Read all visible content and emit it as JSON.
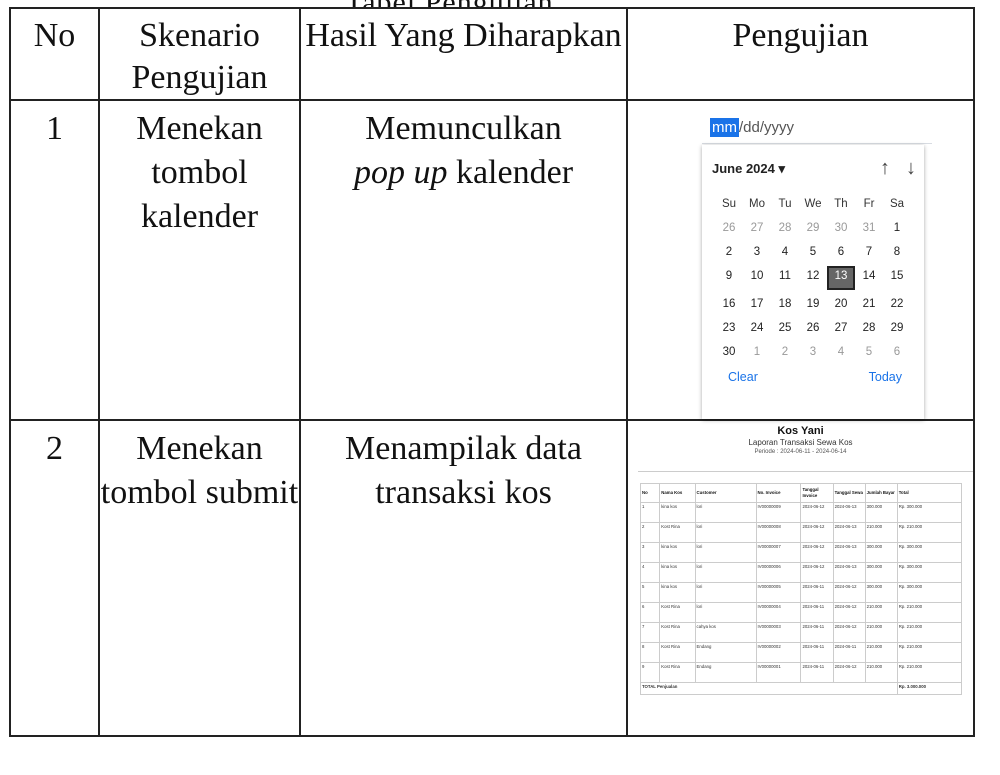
{
  "caption_fragment": "Tabel Pengujian Aplikasi",
  "table": {
    "headers": [
      "No",
      "Skenario Pengujian",
      "Hasil Yang Diharapkan",
      "Pengujian"
    ],
    "rows": [
      {
        "no": "1",
        "scenario": "Menekan tombol kalender",
        "expected_em": "pop up",
        "expected_pre": "Memunculkan",
        "expected_post": "kalender"
      },
      {
        "no": "2",
        "scenario": "Menekan tombol submit",
        "expected_text": "Menampilak data transaksi kos"
      }
    ]
  },
  "datepicker": {
    "input_month": "mm",
    "input_rest": "/dd/yyyy",
    "month_label": "June 2024 ▾",
    "up_arrow": "↑",
    "down_arrow": "↓",
    "weekdays": [
      "Su",
      "Mo",
      "Tu",
      "We",
      "Th",
      "Fr",
      "Sa"
    ],
    "weeks": [
      [
        "26",
        "27",
        "28",
        "29",
        "30",
        "31",
        "1"
      ],
      [
        "2",
        "3",
        "4",
        "5",
        "6",
        "7",
        "8"
      ],
      [
        "9",
        "10",
        "11",
        "12",
        "13",
        "14",
        "15"
      ],
      [
        "16",
        "17",
        "18",
        "19",
        "20",
        "21",
        "22"
      ],
      [
        "23",
        "24",
        "25",
        "26",
        "27",
        "28",
        "29"
      ],
      [
        "30",
        "1",
        "2",
        "3",
        "4",
        "5",
        "6"
      ]
    ],
    "selected": "13",
    "clear_label": "Clear",
    "today_label": "Today"
  },
  "report": {
    "title": "Kos Yani",
    "subtitle": "Laporan Transaksi Sewa Kos",
    "period": "Periode : 2024-06-11 - 2024-06-14",
    "columns": [
      "No",
      "Nama Kos",
      "Customer",
      "No. Invoice",
      "Tanggal Invoice",
      "Tanggal Sewa",
      "Jumlah Bayar",
      "Total"
    ],
    "rows": [
      [
        "1",
        "kina kos",
        "lori",
        "IV00000009",
        "2024-06-12",
        "2024-06-13",
        "300.000",
        "Rp. 300.000"
      ],
      [
        "2",
        "Kost Rina",
        "lori",
        "IV00000008",
        "2024-06-12",
        "2024-06-13",
        "210.000",
        "Rp. 210.000"
      ],
      [
        "3",
        "kina kos",
        "lori",
        "IV00000007",
        "2024-06-12",
        "2024-06-13",
        "300.000",
        "Rp. 300.000"
      ],
      [
        "4",
        "kina kos",
        "lori",
        "IV00000006",
        "2024-06-12",
        "2024-06-13",
        "300.000",
        "Rp. 300.000"
      ],
      [
        "5",
        "kina kos",
        "lori",
        "IV00000005",
        "2024-06-11",
        "2024-06-12",
        "300.000",
        "Rp. 300.000"
      ],
      [
        "6",
        "Kost Rina",
        "lori",
        "IV00000004",
        "2024-06-11",
        "2024-06-12",
        "210.000",
        "Rp. 210.000"
      ],
      [
        "7",
        "Kost Rina",
        "cahya kos",
        "IV00000003",
        "2024-06-11",
        "2024-06-12",
        "210.000",
        "Rp. 210.000"
      ],
      [
        "8",
        "Kost Rina",
        "Endang",
        "IV00000002",
        "2024-06-11",
        "2024-06-11",
        "210.000",
        "Rp. 210.000"
      ],
      [
        "9",
        "Kost Rina",
        "Endang",
        "IV00000001",
        "2024-06-11",
        "2024-06-12",
        "210.000",
        "Rp. 210.000"
      ]
    ],
    "total_label": "TOTAL Penjualan",
    "total_value": "Rp. 3.000.000"
  }
}
